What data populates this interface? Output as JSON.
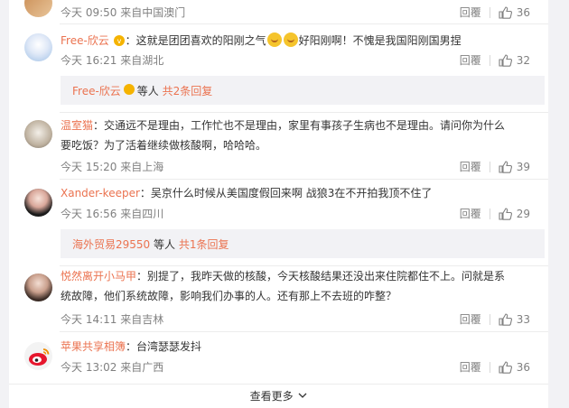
{
  "comments": [
    {
      "avatar_icon": "food-photo-avatar",
      "time": "今天 09:50 来自中国澳门",
      "reply": "回覆",
      "likes": "36"
    },
    {
      "avatar_icon": "anime-girl-avatar",
      "user": "Free-欣云",
      "text_a": "：这就是团团喜欢的阳刚之气",
      "text_b": "好阳刚啊！不愧是我国阳刚国男捏",
      "time": "今天 16:21 来自湖北",
      "reply": "回覆",
      "likes": "32",
      "sub": {
        "user": "Free-欣云",
        "suffix": "等人",
        "link": "共2条回复"
      }
    },
    {
      "avatar_icon": "cartoon-avatar",
      "user": "温室猫",
      "text": "：交通远不是理由，工作忙也不是理由，家里有事孩子生病也不是理由。请问你为什么要吃饭？为了活着继续做核酸啊，哈哈哈。",
      "time": "今天 15:20 来自上海",
      "reply": "回覆",
      "likes": "39"
    },
    {
      "avatar_icon": "girl-photo-avatar",
      "user": "Xander-keeper",
      "text": "：吴京什么时候从美国度假回来啊 战狼3在不开拍我顶不住了",
      "time": "今天 16:56 来自四川",
      "reply": "回覆",
      "likes": "29",
      "sub": {
        "user": "海外贸易29550",
        "suffix": "等人",
        "link": "共1条回复"
      }
    },
    {
      "avatar_icon": "woman-photo-avatar",
      "user": "悦然离开小马甲",
      "text": "：别提了，我昨天做的核酸，今天核酸结果还没出来住院都住不上。问就是系统故障，他们系统故障，影响我们办事的人。还有那上不去班的咋整？",
      "time": "今天 14:11 来自吉林",
      "reply": "回覆",
      "likes": "33"
    },
    {
      "avatar_icon": "weibo-logo-avatar",
      "user": "苹果共享相簿",
      "text": "：台湾瑟瑟发抖",
      "time": "今天 13:02 来自广西",
      "reply": "回覆",
      "likes": "36"
    }
  ],
  "more_label": "查看更多",
  "colors": {
    "username": "#eb7350",
    "meta": "#808080",
    "sub_bg": "#f2f2f5"
  }
}
